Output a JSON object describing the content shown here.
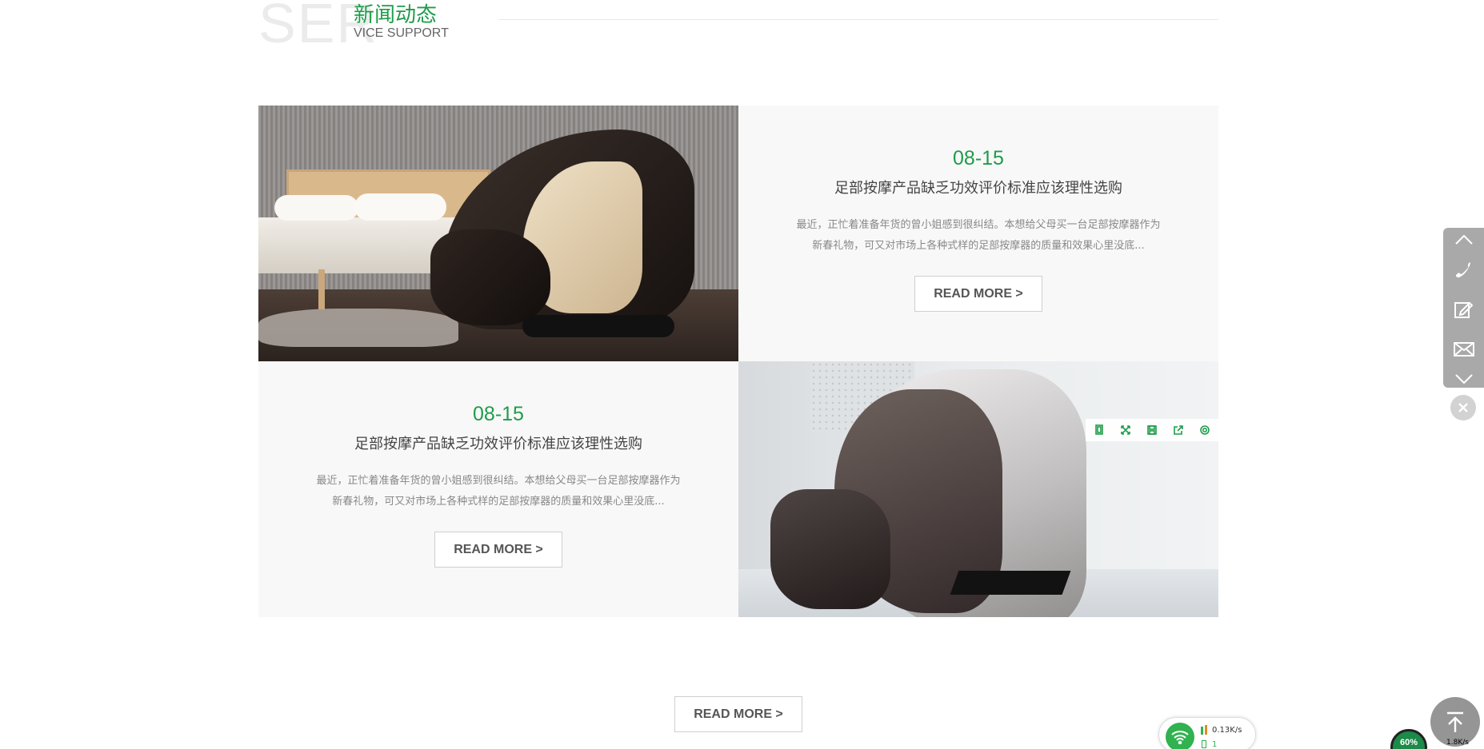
{
  "section": {
    "bg_text": "SER",
    "title_cn": "新闻动态",
    "subtitle_en": "VICE SUPPORT"
  },
  "news": [
    {
      "date": "08-15",
      "title": "足部按摩产品缺乏功效评价标准应该理性选购",
      "excerpt_line1": "最近，正忙着准备年货的曾小姐感到很纠结。本想给父母买一台足部按摩器作为",
      "excerpt_line2": "新春礼物，可又对市场上各种式样的足部按摩器的质量和效果心里没底...",
      "button": "READ MORE >"
    },
    {
      "date": "08-15",
      "title": "足部按摩产品缺乏功效评价标准应该理性选购",
      "excerpt_line1": "最近，正忙着准备年货的曾小姐感到很纠结。本想给父母买一台足部按摩器作为",
      "excerpt_line2": "新春礼物，可又对市场上各种式样的足部按摩器的质量和效果心里没底...",
      "button": "READ MORE >"
    }
  ],
  "main_button": "READ MORE >",
  "image_toolbar_icons": [
    "copy-icon",
    "fullscreen-icon",
    "save-icon",
    "share-icon",
    "settings-icon"
  ],
  "sidebar_icons": [
    "chevron-up-icon",
    "phone-icon",
    "edit-icon",
    "mail-icon",
    "chevron-down-icon"
  ],
  "network": {
    "speed": "0.13K/s",
    "count": "1"
  },
  "taskbar": {
    "percent": "60%",
    "rate": "1.8K/s"
  },
  "colors": {
    "accent": "#1e9c4a",
    "sidebar": "#a9a9a9"
  }
}
